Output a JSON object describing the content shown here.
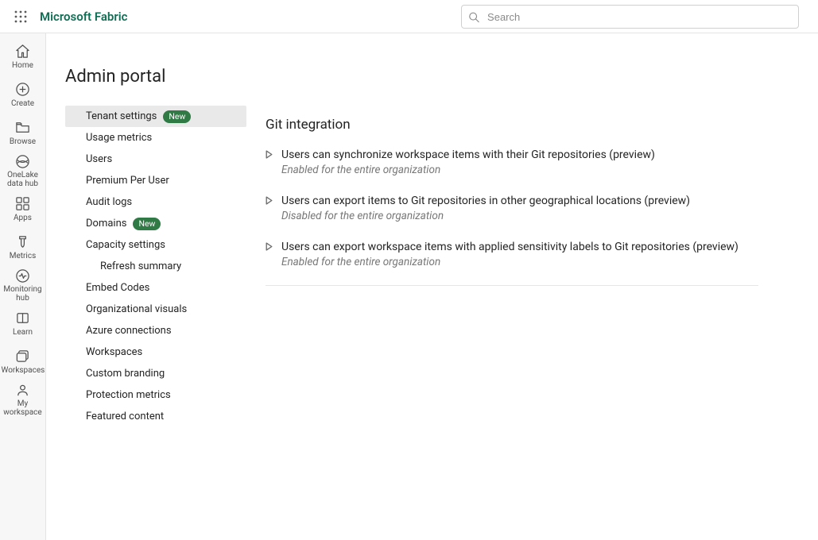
{
  "topbar": {
    "brand": "Microsoft Fabric",
    "search_placeholder": "Search"
  },
  "rail": {
    "items": [
      {
        "id": "home",
        "label": "Home"
      },
      {
        "id": "create",
        "label": "Create"
      },
      {
        "id": "browse",
        "label": "Browse"
      },
      {
        "id": "onelake",
        "label": "OneLake data hub"
      },
      {
        "id": "apps",
        "label": "Apps"
      },
      {
        "id": "metrics",
        "label": "Metrics"
      },
      {
        "id": "monitoring",
        "label": "Monitoring hub"
      },
      {
        "id": "learn",
        "label": "Learn"
      },
      {
        "id": "workspaces",
        "label": "Workspaces"
      },
      {
        "id": "myworkspace",
        "label": "My workspace"
      }
    ]
  },
  "page": {
    "title": "Admin portal"
  },
  "subnav": {
    "new_badge": "New",
    "items": [
      {
        "label": "Tenant settings",
        "selected": true,
        "new": true
      },
      {
        "label": "Usage metrics"
      },
      {
        "label": "Users"
      },
      {
        "label": "Premium Per User"
      },
      {
        "label": "Audit logs"
      },
      {
        "label": "Domains",
        "new": true
      },
      {
        "label": "Capacity settings"
      },
      {
        "label": "Refresh summary",
        "indent": true
      },
      {
        "label": "Embed Codes"
      },
      {
        "label": "Organizational visuals"
      },
      {
        "label": "Azure connections"
      },
      {
        "label": "Workspaces"
      },
      {
        "label": "Custom branding"
      },
      {
        "label": "Protection metrics"
      },
      {
        "label": "Featured content"
      }
    ]
  },
  "content": {
    "section_title": "Git integration",
    "settings": [
      {
        "title": "Users can synchronize workspace items with their Git repositories (preview)",
        "status": "Enabled for the entire organization"
      },
      {
        "title": "Users can export items to Git repositories in other geographical locations (preview)",
        "status": "Disabled for the entire organization"
      },
      {
        "title": "Users can export workspace items with applied sensitivity labels to Git repositories (preview)",
        "status": "Enabled for the entire organization"
      }
    ]
  }
}
